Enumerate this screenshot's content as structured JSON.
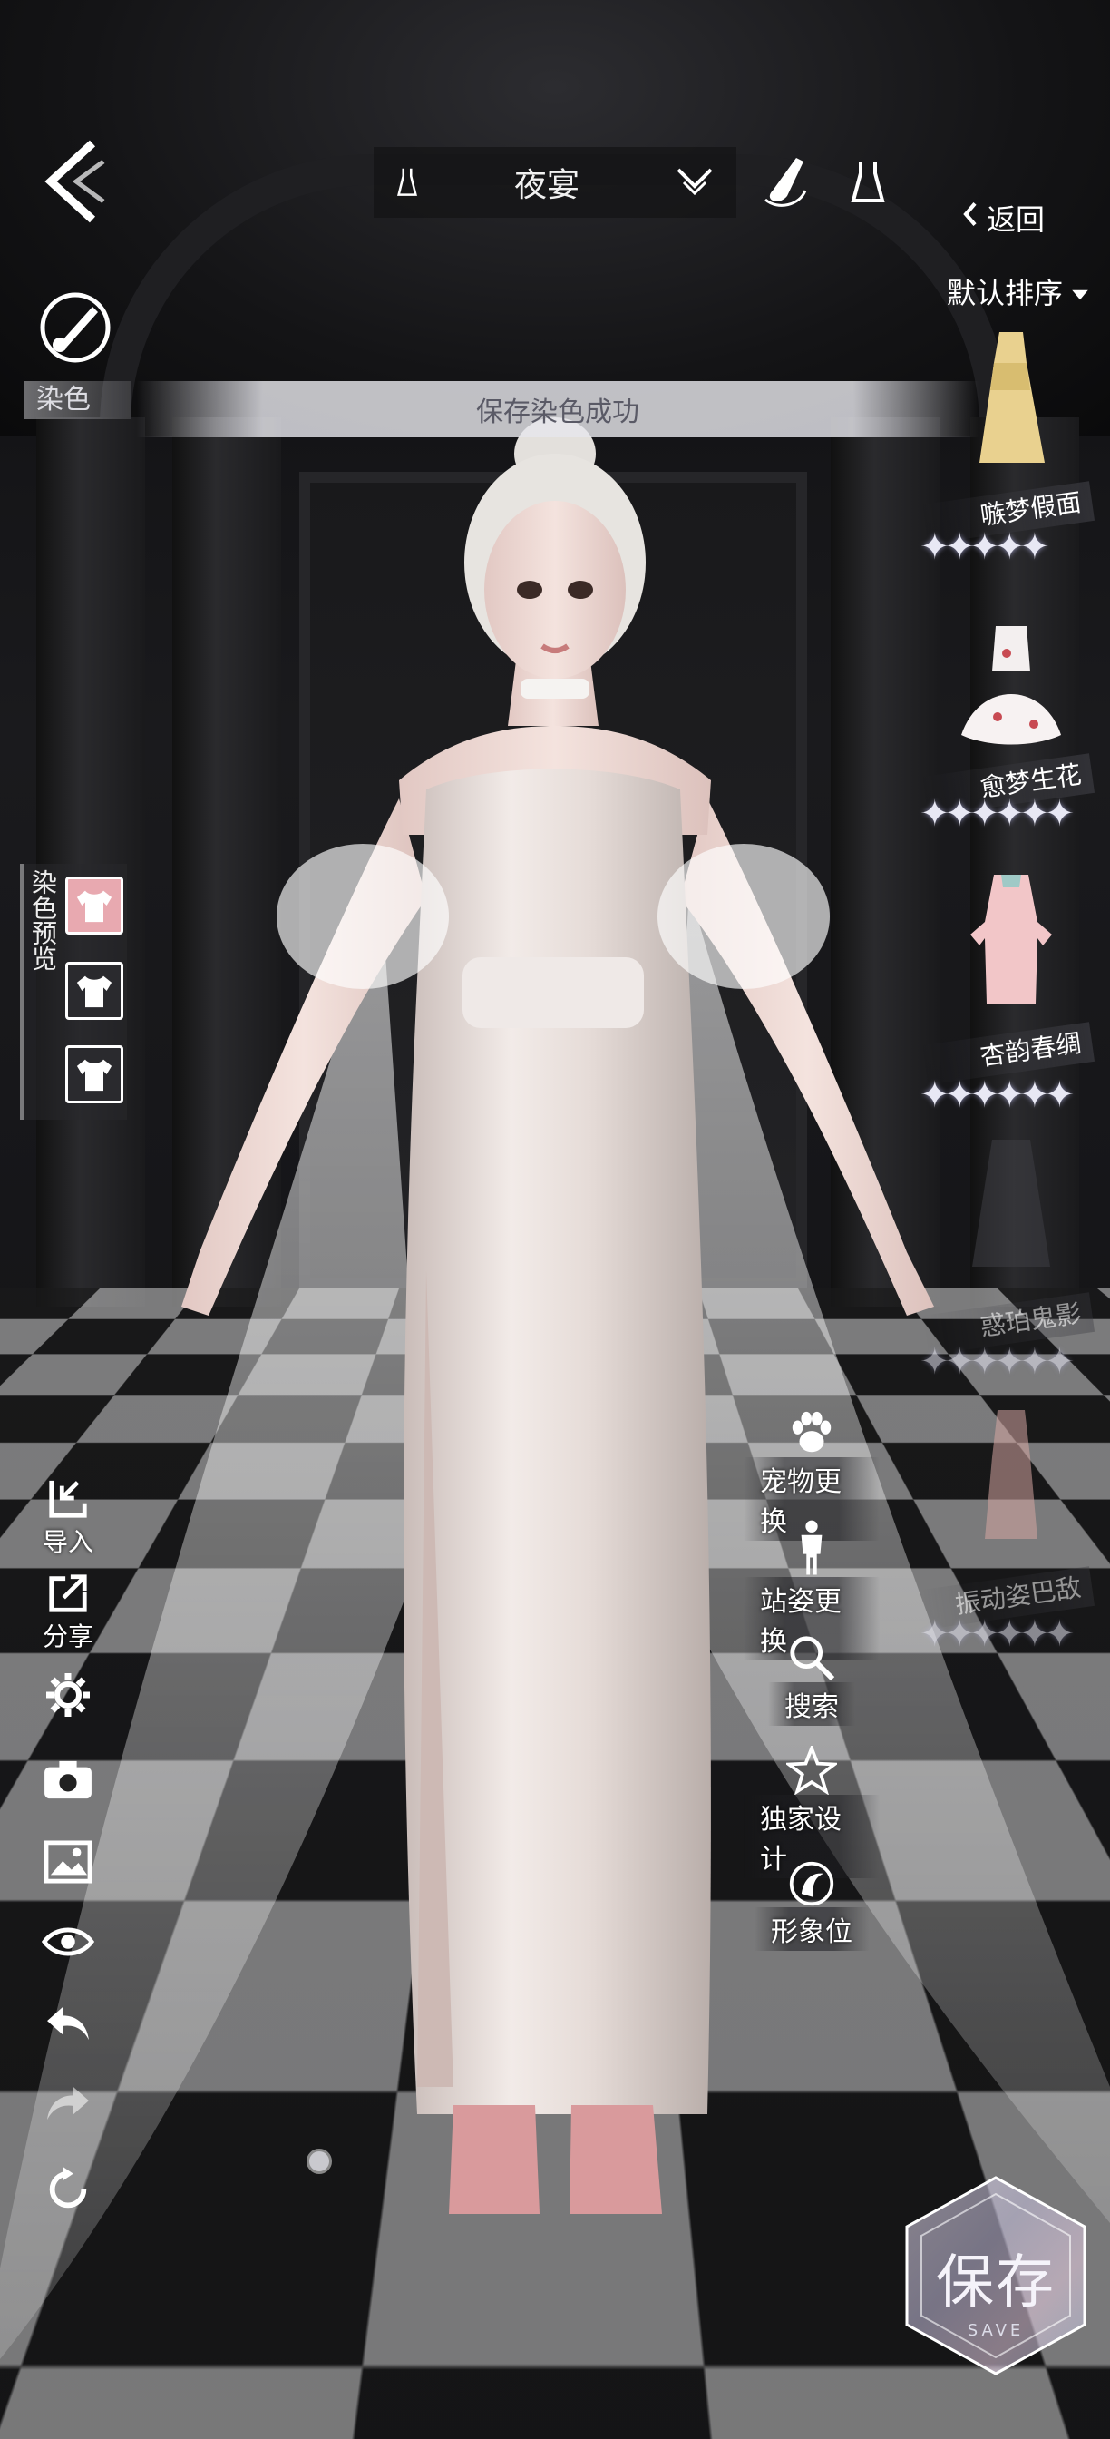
{
  "header": {
    "outfit_name": "夜宴",
    "return_label": "返回",
    "sort_label": "默认排序"
  },
  "dye": {
    "label": "染色",
    "toast": "保存染色成功",
    "preview_title": "染色预览",
    "swatches": [
      {
        "color": "#e8a9b0",
        "selected": true
      },
      {
        "color": "#ffffff",
        "selected": false
      },
      {
        "color": "#ffffff",
        "selected": false
      }
    ]
  },
  "left_tools": {
    "import_label": "导入",
    "share_label": "分享"
  },
  "actions": {
    "pet": "宠物更换",
    "pose": "站姿更换",
    "search": "搜索",
    "exclusive": "独家设计",
    "image_slot": "形象位"
  },
  "outfits": [
    {
      "name": "嗾梦假面",
      "stars": 5,
      "icon": "gold-dress-icon"
    },
    {
      "name": "愈梦生花",
      "stars": 6,
      "icon": "white-tutu-dress-icon"
    },
    {
      "name": "杏韵春绸",
      "stars": 6,
      "icon": "pink-qipao-icon"
    },
    {
      "name": "惑珀鬼影",
      "stars": 6,
      "icon": "dark-lace-dress-icon"
    },
    {
      "name": "振动姿巴敌",
      "stars": 6,
      "icon": "rose-dress-icon"
    }
  ],
  "save": {
    "label": "保存",
    "sub": "SAVE"
  },
  "colors": {
    "accent": "#e8e8f4",
    "toast_text": "#5a5a66",
    "shoe": "#d99a9c"
  }
}
